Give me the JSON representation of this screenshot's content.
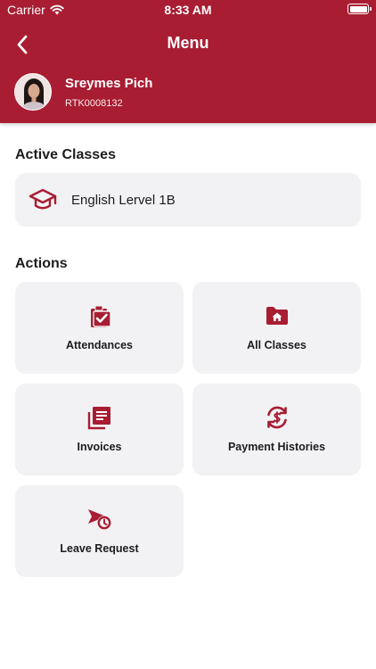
{
  "status_bar": {
    "carrier": "Carrier",
    "time": "8:33 AM"
  },
  "nav": {
    "title": "Menu"
  },
  "profile": {
    "name": "Sreymes Pich",
    "id": "RTK0008132"
  },
  "active_classes": {
    "title": "Active Classes",
    "items": [
      {
        "label": "English Lervel 1B",
        "icon": "graduation-cap-icon"
      }
    ]
  },
  "actions": {
    "title": "Actions",
    "items": [
      {
        "label": "Attendances",
        "icon": "clipboard-check-icon"
      },
      {
        "label": "All Classes",
        "icon": "folder-home-icon"
      },
      {
        "label": "Invoices",
        "icon": "document-list-icon"
      },
      {
        "label": "Payment Histories",
        "icon": "payment-history-icon"
      },
      {
        "label": "Leave Request",
        "icon": "leave-clock-icon"
      }
    ]
  },
  "colors": {
    "primary": "#a81d32",
    "card": "#f2f2f4",
    "text": "#1c1c1e"
  }
}
